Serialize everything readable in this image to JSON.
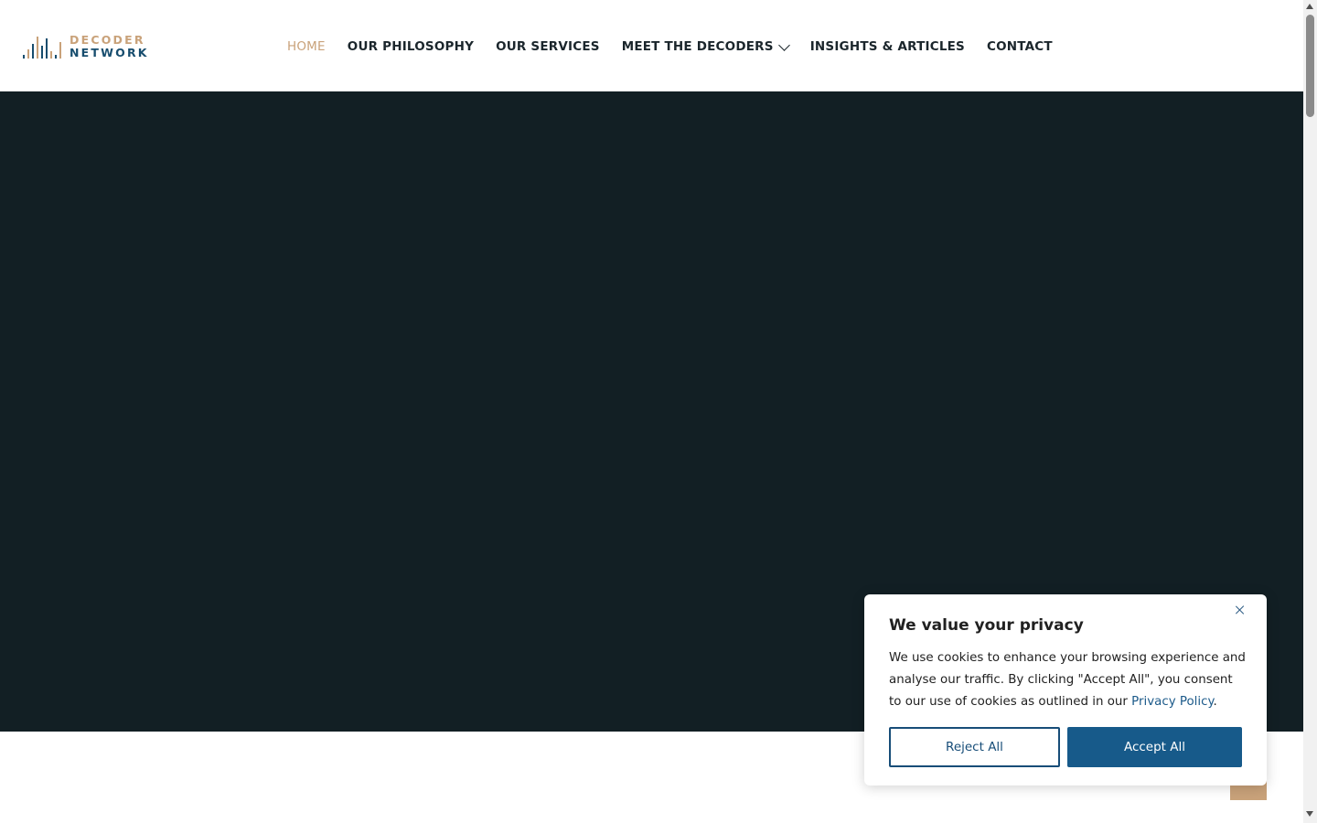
{
  "logo": {
    "line1": "DECODER",
    "line2": "NETWORK",
    "icon": "equalizer-bars-logo"
  },
  "nav": {
    "items": [
      {
        "label": "HOME",
        "active": true
      },
      {
        "label": "OUR PHILOSOPHY"
      },
      {
        "label": "OUR SERVICES"
      },
      {
        "label": "MEET THE DECODERS",
        "has_dropdown": true,
        "icon": "chevron-down-icon"
      },
      {
        "label": "INSIGHTS & ARTICLES"
      },
      {
        "label": "CONTACT"
      }
    ]
  },
  "cookie": {
    "title": "We value your privacy",
    "text_before_link": "We use cookies to enhance your browsing experience and analyse our traffic. By clicking \"Accept All\", you consent to our use of cookies as outlined in our ",
    "link_text": "Privacy Policy",
    "text_after_link": ".",
    "reject_label": "Reject All",
    "accept_label": "Accept All",
    "close_icon": "close-icon"
  },
  "colors": {
    "accent": "#c9a27a",
    "brand_blue": "#174d6e",
    "hero_bg": "#121f24",
    "button_blue": "#175a8a"
  }
}
